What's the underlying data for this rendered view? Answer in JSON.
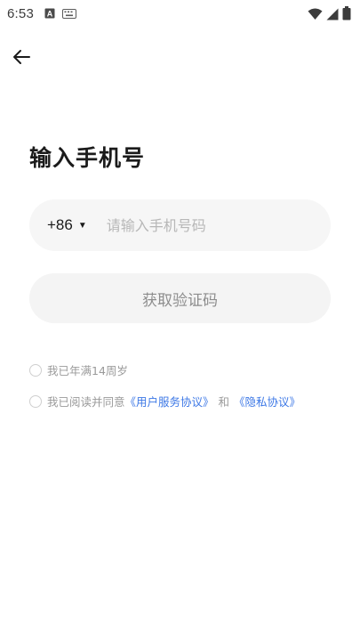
{
  "status_bar": {
    "time": "6:53",
    "left_icons": [
      "a-app-icon",
      "keyboard-icon"
    ],
    "right_icons": [
      "wifi-icon",
      "signal-icon",
      "battery-icon"
    ]
  },
  "nav": {
    "back_icon": "arrow-left-icon"
  },
  "title": "输入手机号",
  "phone": {
    "country_code": "+86",
    "caret": "▼",
    "placeholder": "请输入手机号码",
    "value": ""
  },
  "get_code_label": "获取验证码",
  "checks": {
    "age_label": "我已年满14周岁",
    "agree_prefix": "我已阅读并同意",
    "user_agreement": "《用户服务协议》",
    "and": "和",
    "privacy": "《隐私协议》"
  },
  "colors": {
    "accent_link": "#3d78e6",
    "field_bg": "#f6f6f6"
  }
}
